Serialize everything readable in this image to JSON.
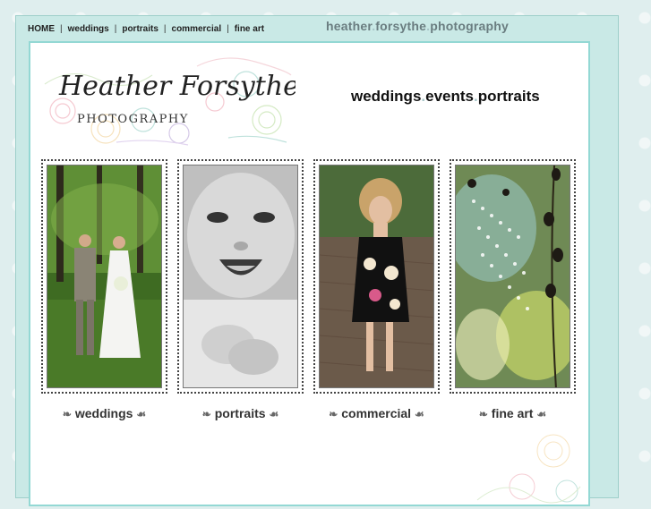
{
  "nav": {
    "items": [
      {
        "label": "HOME"
      },
      {
        "label": "weddings"
      },
      {
        "label": "portraits"
      },
      {
        "label": "commercial"
      },
      {
        "label": "fine art"
      }
    ],
    "separator": "|"
  },
  "site_title": {
    "parts": [
      "heather",
      "forsythe",
      "photography"
    ],
    "dot": "."
  },
  "logo": {
    "script_text": "Heather Forsythe",
    "sub_text": "PHOTOGRAPHY"
  },
  "tagline": {
    "parts": [
      "weddings",
      "events",
      "portraits"
    ],
    "dot": "."
  },
  "galleries": [
    {
      "label": "weddings",
      "icon": "bride-groom-photo"
    },
    {
      "label": "portraits",
      "icon": "baby-portrait-photo"
    },
    {
      "label": "commercial",
      "icon": "model-fashion-photo"
    },
    {
      "label": "fine art",
      "icon": "dewdrops-photo"
    }
  ],
  "ornament_left": "❧",
  "ornament_right": "☙",
  "colors": {
    "frame": "#c9e9e6",
    "panel_border": "#93d8d4",
    "title_gray": "#6a7d80",
    "accent_dot": "#a8c6c8"
  }
}
